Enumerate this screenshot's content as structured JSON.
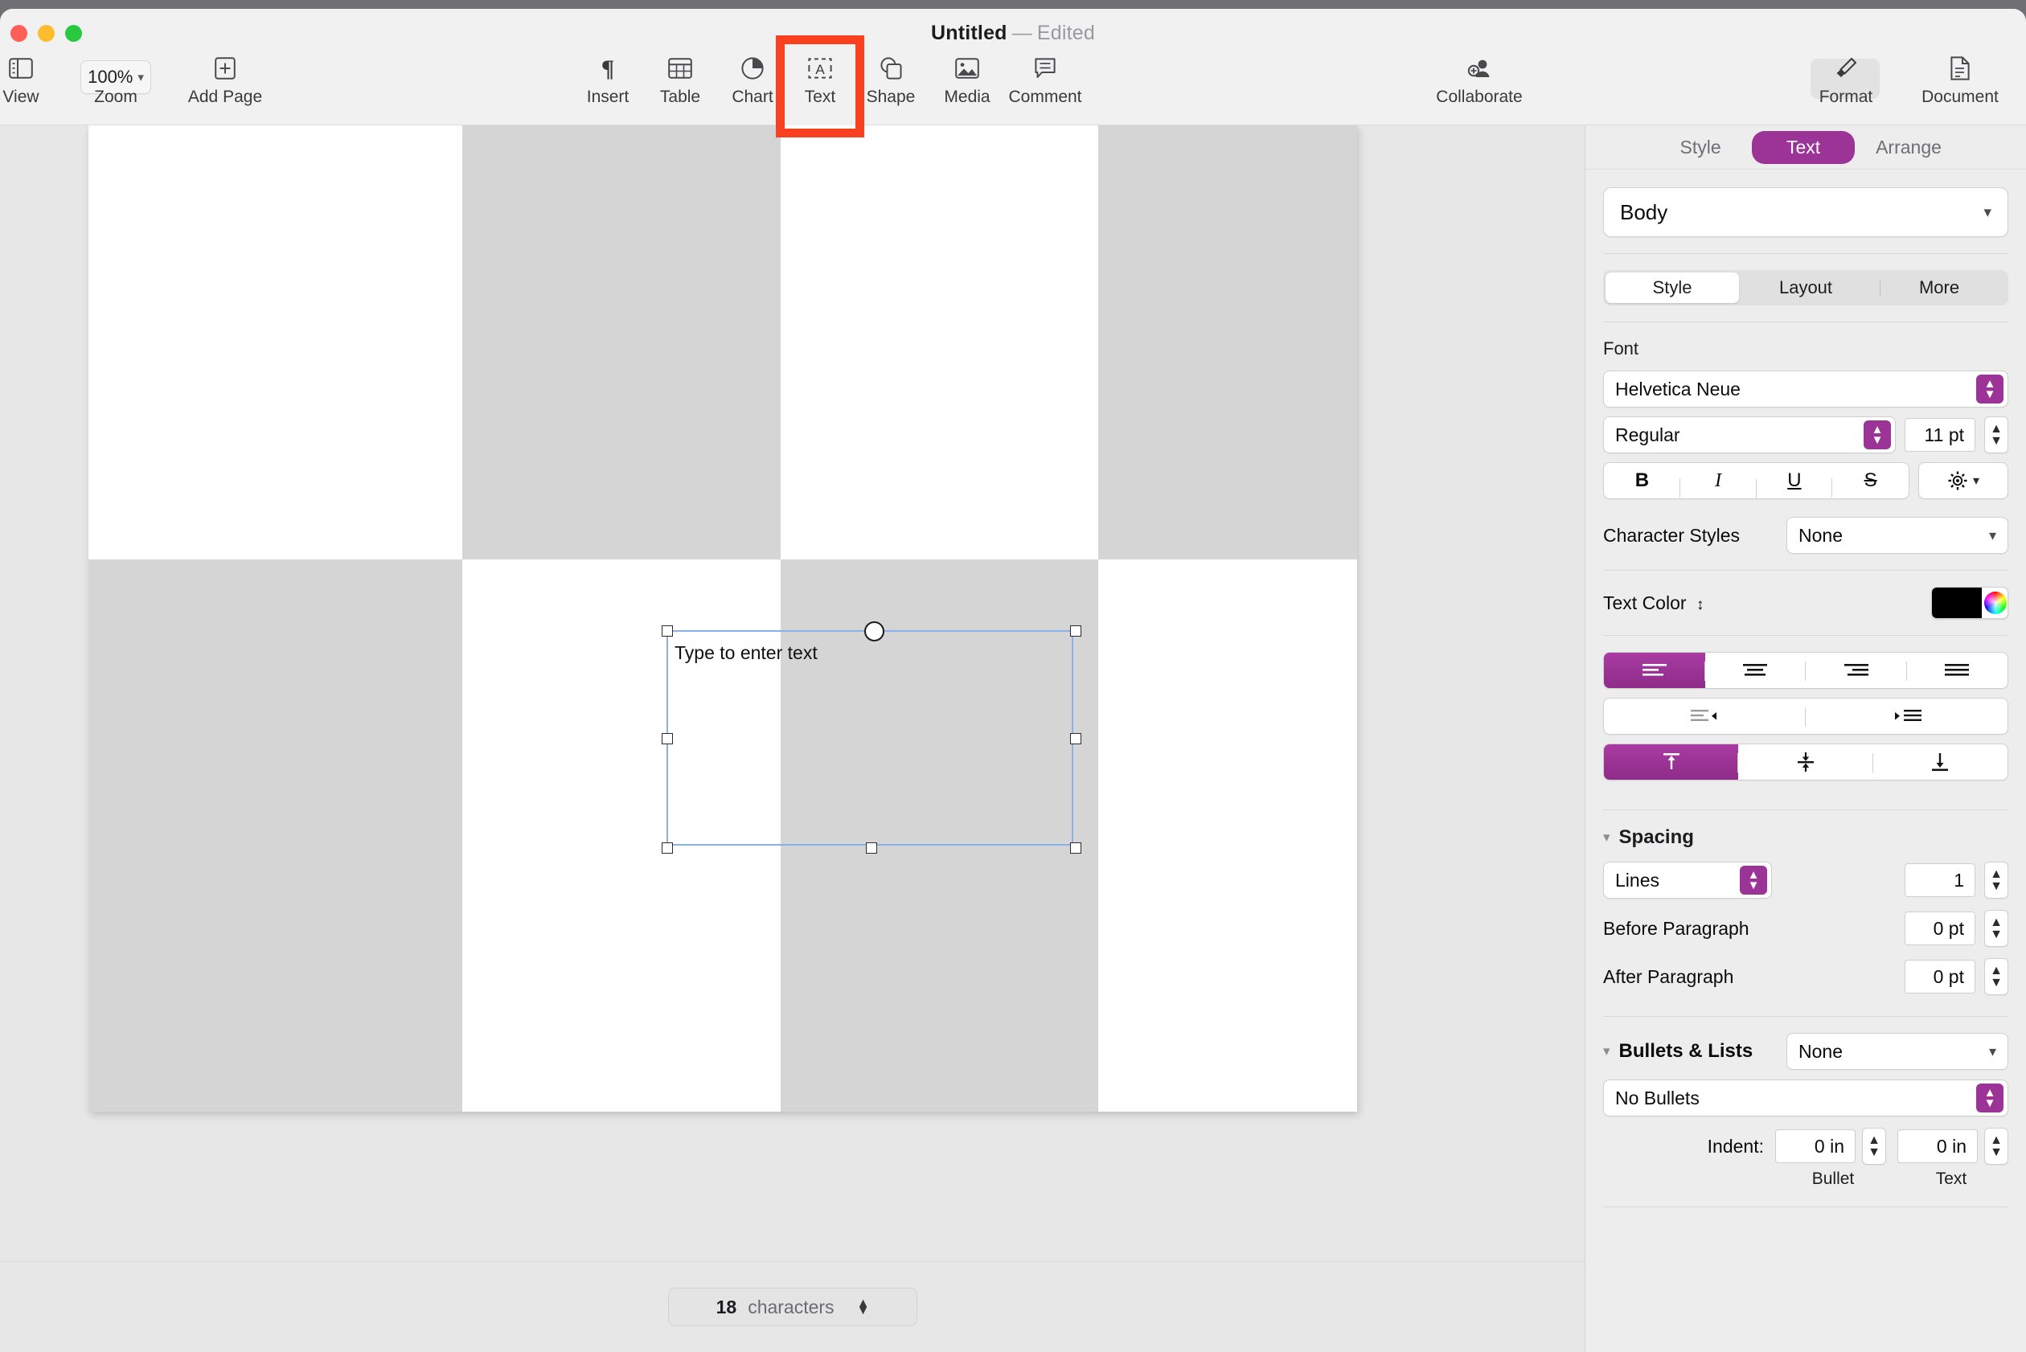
{
  "window": {
    "title_name": "Untitled",
    "title_dash": "—",
    "title_state": "Edited"
  },
  "toolbar": {
    "zoom_value": "100%",
    "zoom_chevron": "chevron-down-icon",
    "items": [
      {
        "label": "View",
        "icon": "sidebar-icon"
      },
      {
        "label": "Zoom",
        "icon": "zoom-popup"
      },
      {
        "label": "Add Page",
        "icon": "add-page-icon"
      },
      {
        "label": "Insert",
        "icon": "pilcrow-icon"
      },
      {
        "label": "Table",
        "icon": "table-icon"
      },
      {
        "label": "Chart",
        "icon": "pie-chart-icon"
      },
      {
        "label": "Text",
        "icon": "text-box-icon"
      },
      {
        "label": "Shape",
        "icon": "shape-icon"
      },
      {
        "label": "Media",
        "icon": "media-icon"
      },
      {
        "label": "Comment",
        "icon": "comment-icon"
      },
      {
        "label": "Collaborate",
        "icon": "collaborate-icon"
      },
      {
        "label": "Format",
        "icon": "format-brush-icon"
      },
      {
        "label": "Document",
        "icon": "document-icon"
      }
    ],
    "highlighted_item": "Text"
  },
  "canvas": {
    "textbox": {
      "placeholder": "Type to enter text"
    },
    "status": {
      "count": "18",
      "unit": "characters"
    }
  },
  "sidebar": {
    "tabs": [
      {
        "label": "Style",
        "active": false
      },
      {
        "label": "Text",
        "active": true
      },
      {
        "label": "Arrange",
        "active": false
      }
    ],
    "paragraph_style": "Body",
    "subtabs": [
      {
        "label": "Style",
        "active": true
      },
      {
        "label": "Layout",
        "active": false
      },
      {
        "label": "More",
        "active": false
      }
    ],
    "font": {
      "section_title": "Font",
      "family": "Helvetica Neue",
      "weight": "Regular",
      "size": "11 pt",
      "bold": "B",
      "italic": "I",
      "underline": "U",
      "strikethrough": "S",
      "gear": "gear-icon"
    },
    "character_styles": {
      "label": "Character Styles",
      "value": "None"
    },
    "text_color": {
      "label": "Text Color",
      "swatch": "#000000"
    },
    "alignment": {
      "horizontal_active": "align-left",
      "vertical_active": "align-top"
    },
    "spacing": {
      "title": "Spacing",
      "mode": "Lines",
      "lines_value": "1",
      "before_label": "Before Paragraph",
      "before_value": "0 pt",
      "after_label": "After Paragraph",
      "after_value": "0 pt"
    },
    "bullets": {
      "title": "Bullets & Lists",
      "preset": "None",
      "type": "No Bullets",
      "indent_label": "Indent:",
      "bullet_indent": "0 in",
      "text_indent": "0 in",
      "bullet_cap": "Bullet",
      "text_cap": "Text"
    },
    "accent_color": "#9c3396"
  }
}
